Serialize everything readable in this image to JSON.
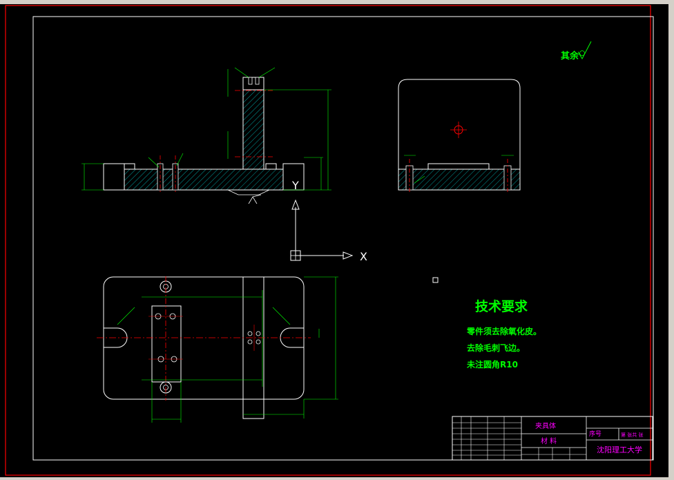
{
  "drawing": {
    "surface_note": "其余",
    "tech_req": {
      "title": "技术要求",
      "items": [
        "零件须去除氧化皮。",
        "去除毛刺飞边。",
        "未注圆角R10"
      ]
    },
    "ucs": {
      "y_label": "Y",
      "x_label": "X"
    },
    "title_block": {
      "part_name": "夹具体",
      "material_label": "材  料",
      "seq_label": "序号",
      "sheet_label": "第  张共  张",
      "school": "沈阳理工大学"
    }
  },
  "colors": {
    "background": "#000000",
    "line_white": "#ffffff",
    "dimension_green": "#00ff00",
    "centerline_red": "#ff0000",
    "frame_red": "#ff0000",
    "hatch_cyan": "#00c8c8",
    "title_block_magenta": "#ff00ff"
  }
}
